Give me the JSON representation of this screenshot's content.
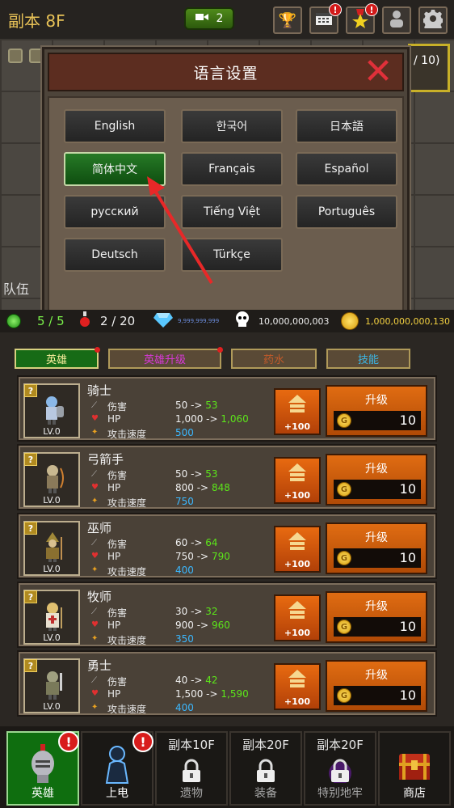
{
  "header": {
    "floor_title": "副本 8F",
    "ticket_count": "2",
    "buttons": [
      {
        "name": "trophy",
        "icon": "trophy-icon",
        "alert": false
      },
      {
        "name": "calendar",
        "icon": "calendar-icon",
        "alert": true
      },
      {
        "name": "achievement",
        "icon": "star-medal-icon",
        "alert": true
      },
      {
        "name": "profile",
        "icon": "person-icon",
        "alert": false
      },
      {
        "name": "settings",
        "icon": "gear-icon",
        "alert": false
      }
    ]
  },
  "background": {
    "count_text": "/ 10)",
    "party_label": "队伍"
  },
  "language_modal": {
    "title": "语言设置",
    "close_icon": "close-x-icon",
    "languages": [
      {
        "label": "English",
        "selected": false
      },
      {
        "label": "한국어",
        "selected": false
      },
      {
        "label": "日本語",
        "selected": false
      },
      {
        "label": "简体中文",
        "selected": true
      },
      {
        "label": "Français",
        "selected": false
      },
      {
        "label": "Español",
        "selected": false
      },
      {
        "label": "русский",
        "selected": false
      },
      {
        "label": "Tiếng Việt",
        "selected": false
      },
      {
        "label": "Português",
        "selected": false
      },
      {
        "label": "Deutsch",
        "selected": false
      },
      {
        "label": "Türkçe",
        "selected": false
      }
    ]
  },
  "stats": {
    "gems": "5 / 5",
    "potion": "2 / 20",
    "diamond": "9,999,999,999",
    "skulls": "10,000,000,003",
    "gold": "1,000,000,000,130"
  },
  "tabs": [
    {
      "label": "英雄",
      "active": true,
      "dot": true
    },
    {
      "label": "英雄升级",
      "active": false,
      "dot": true
    },
    {
      "label": "药水",
      "active": false,
      "dot": false
    },
    {
      "label": "技能",
      "active": false,
      "dot": false
    }
  ],
  "hero_common": {
    "damage_label": "伤害",
    "hp_label": "HP",
    "speed_label": "攻击速度",
    "plus_label": "+100",
    "upgrade_label": "升级",
    "level": "LV.0"
  },
  "heroes": [
    {
      "name": "骑士",
      "damage": "50 ->",
      "damage_new": "53",
      "hp": "1,000 ->",
      "hp_new": "1,060",
      "speed": "500",
      "cost": "10"
    },
    {
      "name": "弓箭手",
      "damage": "50 ->",
      "damage_new": "53",
      "hp": "800 ->",
      "hp_new": "848",
      "speed": "750",
      "cost": "10"
    },
    {
      "name": "巫师",
      "damage": "60 ->",
      "damage_new": "64",
      "hp": "750 ->",
      "hp_new": "790",
      "speed": "400",
      "cost": "10"
    },
    {
      "name": "牧师",
      "damage": "30 ->",
      "damage_new": "32",
      "hp": "900 ->",
      "hp_new": "960",
      "speed": "350",
      "cost": "10"
    },
    {
      "name": "勇士",
      "damage": "40 ->",
      "damage_new": "42",
      "hp": "1,500 ->",
      "hp_new": "1,590",
      "speed": "400",
      "cost": "10"
    }
  ],
  "bottom_nav": [
    {
      "label": "英雄",
      "floor": "",
      "active": true,
      "alert": true,
      "locked": false
    },
    {
      "label": "上电",
      "floor": "",
      "active": false,
      "alert": true,
      "locked": false
    },
    {
      "label": "遗物",
      "floor": "副本10F",
      "active": false,
      "alert": false,
      "locked": true
    },
    {
      "label": "装备",
      "floor": "副本20F",
      "active": false,
      "alert": false,
      "locked": true
    },
    {
      "label": "特别地牢",
      "floor": "副本20F",
      "active": false,
      "alert": false,
      "locked": true
    },
    {
      "label": "商店",
      "floor": "",
      "active": false,
      "alert": false,
      "locked": false
    }
  ],
  "colors": {
    "accent_green": "#176b16",
    "upgrade_orange": "#e06c12",
    "stat_increase": "#5ce61a",
    "speed_blue": "#3bb8ff",
    "alert_red": "#d21a1a"
  }
}
